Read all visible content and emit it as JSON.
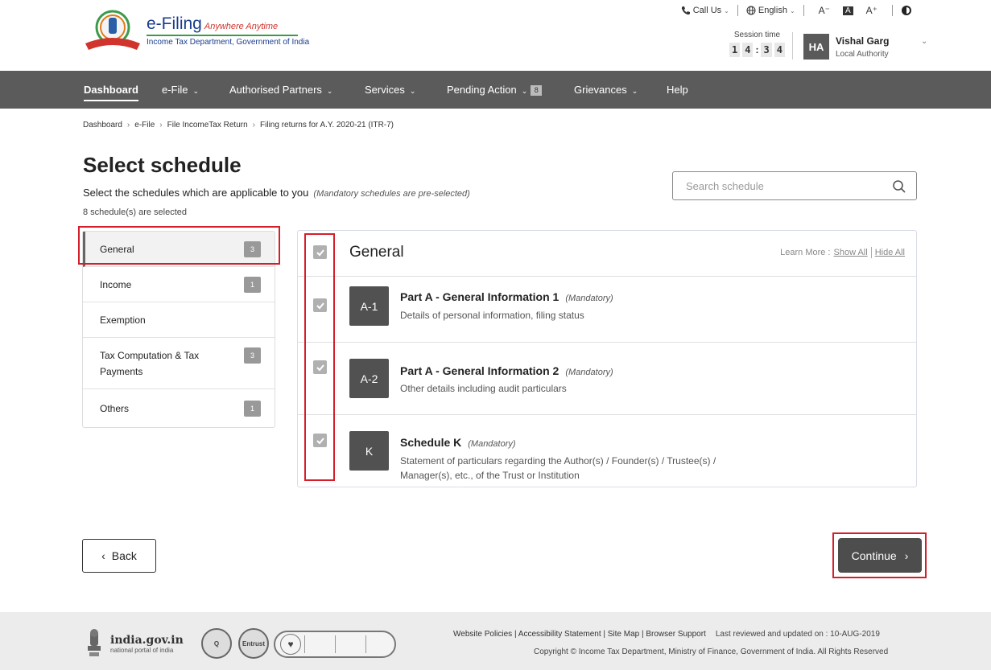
{
  "header": {
    "brand_name": "e-Filing",
    "brand_tagline": "Anywhere Anytime",
    "brand_sub": "Income Tax Department, Government of India",
    "util": {
      "call_us": "Call Us",
      "language": "English",
      "font_decrease": "A⁻",
      "font_normal": "A",
      "font_increase": "A⁺"
    },
    "session_label": "Session time",
    "session_digits": [
      "1",
      "4",
      "3",
      "4"
    ],
    "session_colon": ":",
    "user_initials": "HA",
    "user_name": "Vishal Garg",
    "user_role": "Local Authority"
  },
  "nav": {
    "items": [
      {
        "label": "Dashboard"
      },
      {
        "label": "e-File"
      },
      {
        "label": "Authorised Partners"
      },
      {
        "label": "Services"
      },
      {
        "label": "Pending Action",
        "badge": "8"
      },
      {
        "label": "Grievances"
      },
      {
        "label": "Help"
      }
    ]
  },
  "breadcrumb": [
    "Dashboard",
    "e-File",
    "File IncomeTax Return",
    "Filing returns for A.Y. 2020-21 (ITR-7)"
  ],
  "page": {
    "title": "Select schedule",
    "subtitle": "Select the schedules which are applicable to you",
    "subtitle_note": "(Mandatory schedules are pre-selected)",
    "count_text": "8 schedule(s) are selected",
    "search_placeholder": "Search schedule"
  },
  "categories": [
    {
      "label": "General",
      "count": "3"
    },
    {
      "label": "Income",
      "count": "1"
    },
    {
      "label": "Exemption",
      "count": ""
    },
    {
      "label": "Tax Computation & Tax Payments",
      "count": "3"
    },
    {
      "label": "Others",
      "count": "1"
    }
  ],
  "panel": {
    "title": "General",
    "learn_more": "Learn More :",
    "show_all": "Show All",
    "hide_all": "Hide All",
    "rows": [
      {
        "code": "A-1",
        "title": "Part A - General Information 1",
        "mandatory": "(Mandatory)",
        "desc": "Details of personal information, filing status"
      },
      {
        "code": "A-2",
        "title": "Part A - General Information 2",
        "mandatory": "(Mandatory)",
        "desc": "Other details including audit particulars"
      },
      {
        "code": "K",
        "title": "Schedule K",
        "mandatory": "(Mandatory)",
        "desc": "Statement of particulars regarding the Author(s) / Founder(s) / Trustee(s) / Manager(s), etc., of the Trust or Institution"
      }
    ]
  },
  "buttons": {
    "back": "Back",
    "continue": "Continue"
  },
  "footer": {
    "india_gov": "india.gov.in",
    "india_sub": "national portal of india",
    "cert_q": "Q",
    "cert_entrust": "Entrust",
    "links": "Website Policies | Accessibility Statement | Site Map | Browser Support",
    "reviewed": "Last reviewed and updated on : 10-AUG-2019",
    "copyright": "Copyright © Income Tax Department, Ministry of Finance, Government of India. All Rights Reserved"
  },
  "colors": {
    "nav_bg": "#5b5b5b",
    "highlight_red": "#d41f2b",
    "brand_blue": "#1a3d8f",
    "continue_bg": "#4d4d4d"
  }
}
